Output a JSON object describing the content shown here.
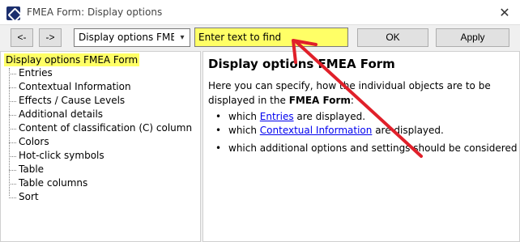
{
  "window": {
    "title": "FMEA Form: Display options",
    "close_glyph": "✕"
  },
  "toolbar": {
    "back_label": "<-",
    "forward_label": "->",
    "select_value": "Display options FMEA Form",
    "find_placeholder": "Enter text to find",
    "ok_label": "OK",
    "apply_label": "Apply"
  },
  "tree": {
    "root": "Display options FMEA Form",
    "items": [
      "Entries",
      "Contextual Information",
      "Effects / Cause Levels",
      "Additional details",
      "Content of classification (C) column",
      "Colors",
      "Hot-click symbols",
      "Table",
      "Table columns",
      "Sort"
    ]
  },
  "content": {
    "title": "Display options FMEA Form",
    "intro_1": "Here you can specify, how the individual objects are to be displayed in the ",
    "intro_bold": "FMEA Form",
    "intro_2": ":",
    "bullet_glyph": "•",
    "bullets": [
      {
        "pre": "which ",
        "link": "Entries",
        "post": " are displayed."
      },
      {
        "pre": "which ",
        "link": "Contextual Information",
        "post": " are displayed."
      },
      {
        "text": "which additional options and settings should be considered"
      }
    ]
  },
  "colors": {
    "highlight": "#ffff66",
    "annotation_arrow": "#e0202a",
    "link": "#0000ee"
  },
  "icons": {
    "app": "fmea-app-icon",
    "select_arrow": "chevron-down-icon",
    "close": "close-icon",
    "annotation": "arrow-annotation-icon"
  }
}
